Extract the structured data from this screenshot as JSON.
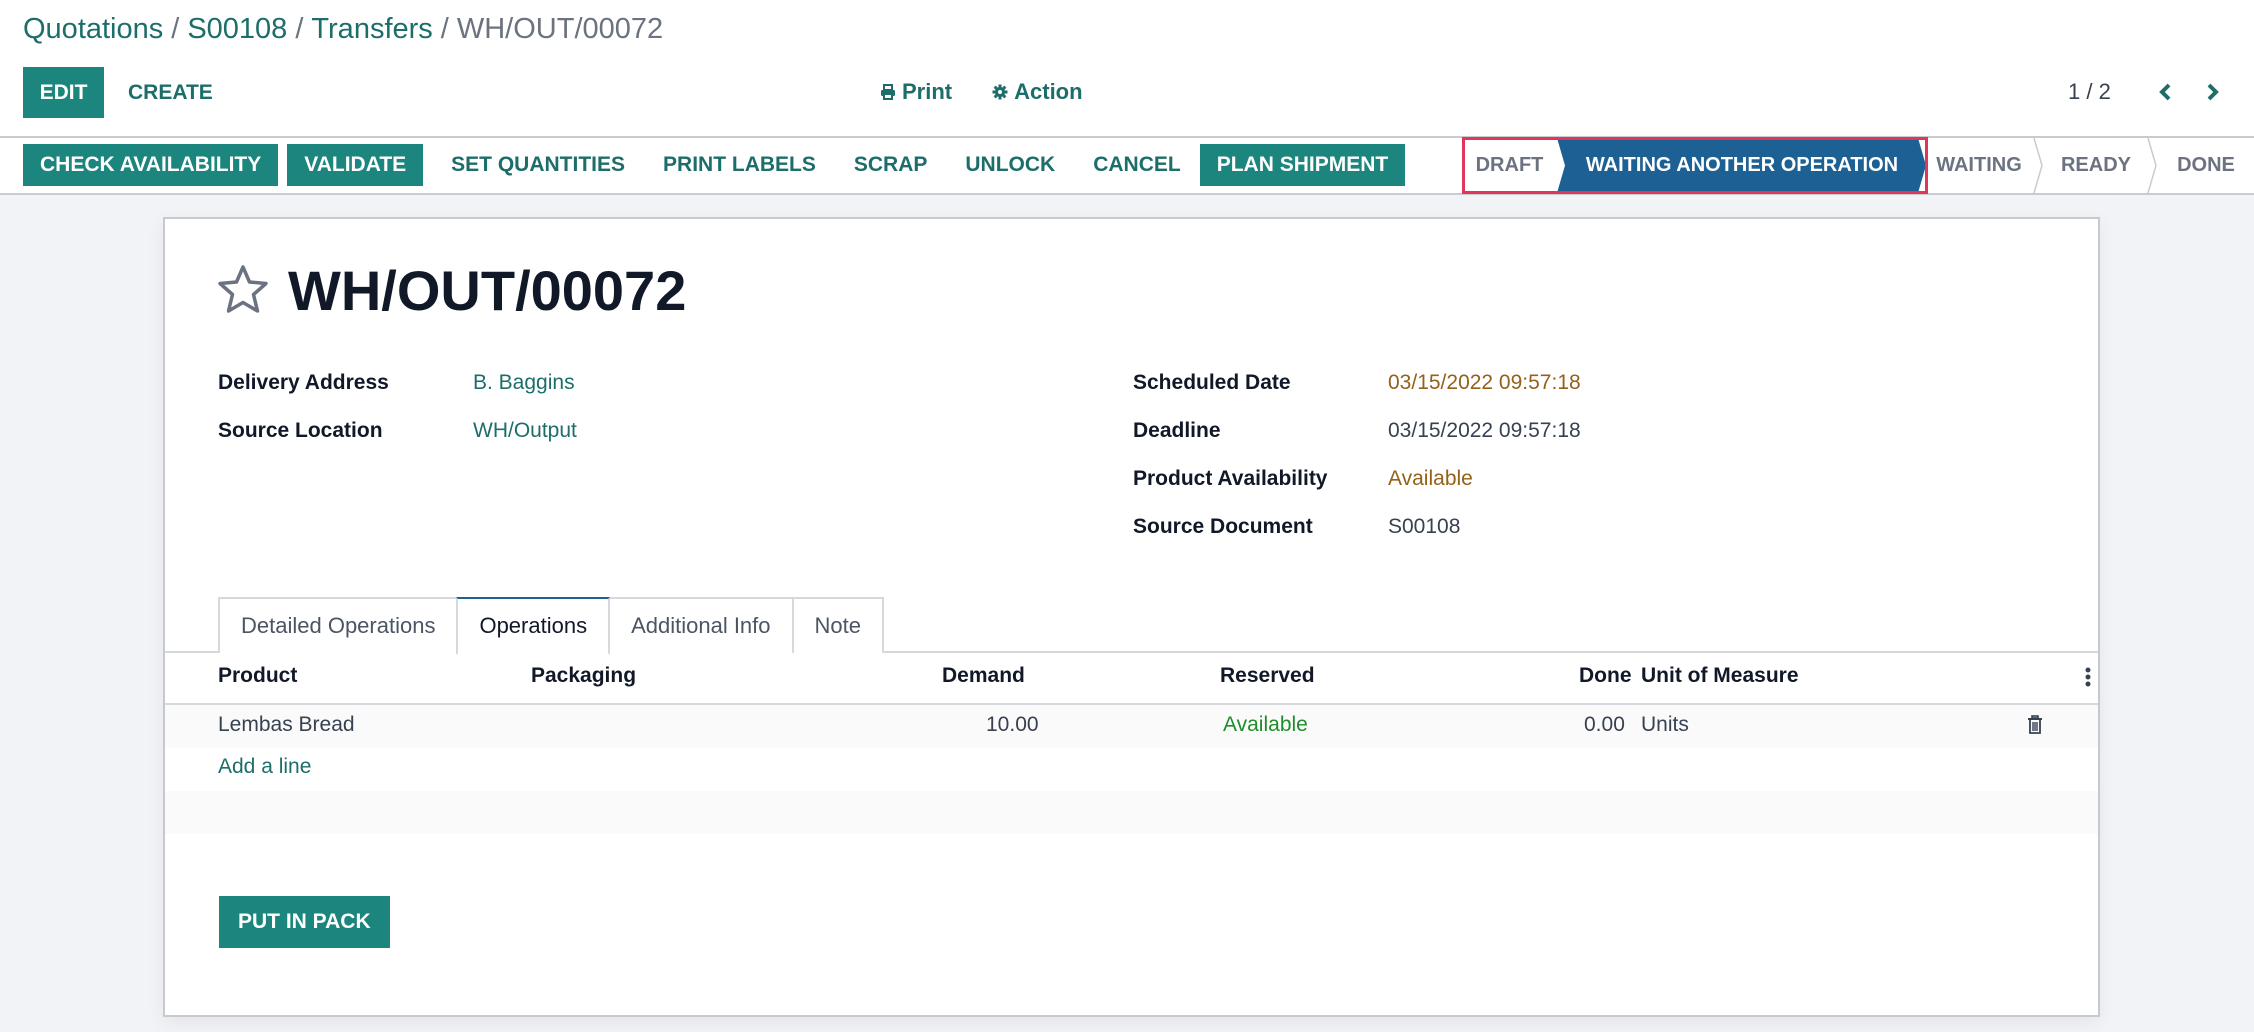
{
  "breadcrumb": {
    "items": [
      {
        "label": "Quotations",
        "link": true
      },
      {
        "label": "S00108",
        "link": true
      },
      {
        "label": "Transfers",
        "link": true
      },
      {
        "label": "WH/OUT/00072",
        "link": false
      }
    ],
    "separator": "/"
  },
  "toolbar": {
    "edit_label": "EDIT",
    "create_label": "CREATE",
    "print_label": "Print",
    "action_label": "Action",
    "print_icon": "print-icon",
    "action_icon": "gear-icon"
  },
  "pager": {
    "value": "1 / 2",
    "prev_icon": "chevron-left-icon",
    "next_icon": "chevron-right-icon"
  },
  "header_buttons": [
    {
      "label": "CHECK AVAILABILITY",
      "style": "primary"
    },
    {
      "label": "VALIDATE",
      "style": "primary"
    },
    {
      "label": "SET QUANTITIES",
      "style": "link"
    },
    {
      "label": "PRINT LABELS",
      "style": "link"
    },
    {
      "label": "SCRAP",
      "style": "link"
    },
    {
      "label": "UNLOCK",
      "style": "link"
    },
    {
      "label": "CANCEL",
      "style": "link"
    },
    {
      "label": "PLAN SHIPMENT",
      "style": "primary"
    }
  ],
  "statusbar": {
    "steps": [
      {
        "label": "DRAFT",
        "active": false
      },
      {
        "label": "WAITING ANOTHER OPERATION",
        "active": true
      },
      {
        "label": "WAITING",
        "active": false
      },
      {
        "label": "READY",
        "active": false
      },
      {
        "label": "DONE",
        "active": false
      }
    ]
  },
  "record": {
    "title": "WH/OUT/00072",
    "favorite_icon": "star-outline-icon",
    "left_fields": [
      {
        "label": "Delivery Address",
        "value": "B. Baggins",
        "style": "link"
      },
      {
        "label": "Source Location",
        "value": "WH/Output",
        "style": "link"
      }
    ],
    "right_fields": [
      {
        "label": "Scheduled Date",
        "value": "03/15/2022 09:57:18",
        "style": "warning"
      },
      {
        "label": "Deadline",
        "value": "03/15/2022 09:57:18",
        "style": "normal"
      },
      {
        "label": "Product Availability",
        "value": "Available",
        "style": "warning"
      },
      {
        "label": "Source Document",
        "value": "S00108",
        "style": "normal"
      }
    ]
  },
  "tabs": [
    {
      "label": "Detailed Operations",
      "active": false
    },
    {
      "label": "Operations",
      "active": true
    },
    {
      "label": "Additional Info",
      "active": false
    },
    {
      "label": "Note",
      "active": false
    }
  ],
  "operations_table": {
    "columns": [
      "Product",
      "Packaging",
      "Demand",
      "Reserved",
      "Done",
      "Unit of Measure"
    ],
    "rows": [
      {
        "product": "Lembas Bread",
        "packaging": "",
        "demand": "10.00",
        "reserved": "Available",
        "done": "0.00",
        "uom": "Units"
      }
    ],
    "add_line_label": "Add a line",
    "options_icon": "vertical-ellipsis-icon",
    "delete_icon": "trash-icon"
  },
  "footer_buttons": {
    "put_in_pack_label": "PUT IN PACK"
  },
  "colors": {
    "brand": "#1c867e",
    "link": "#1d6e6a",
    "status_active": "#1d6094",
    "highlight_border": "#e0365a",
    "warning_text": "#946119",
    "success_text": "#218c2b"
  }
}
